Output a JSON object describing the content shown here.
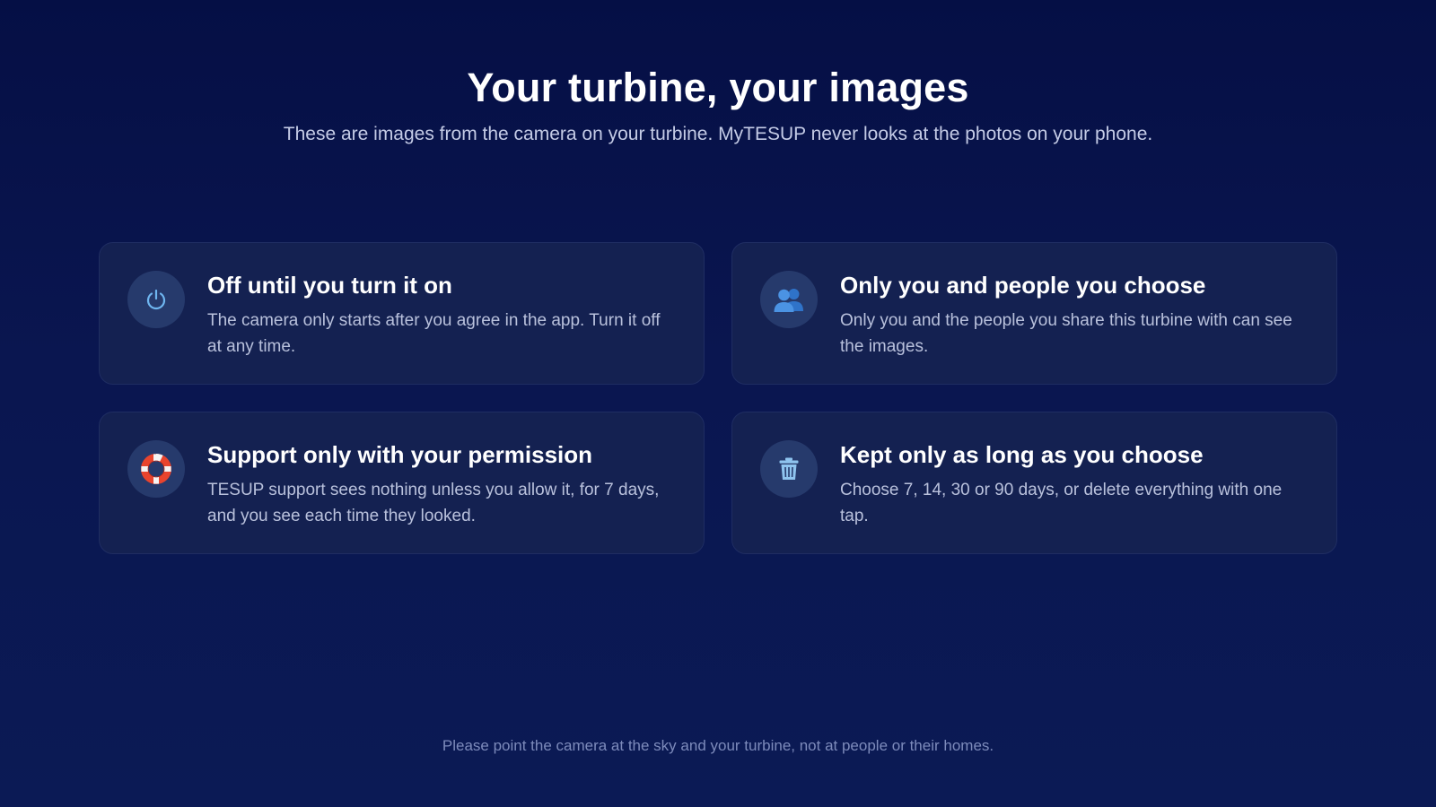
{
  "header": {
    "title": "Your turbine, your images",
    "subtitle": "These are images from the camera on your turbine. MyTESUP never looks at the photos on your phone."
  },
  "cards": [
    {
      "icon": "power-icon",
      "title": "Off until you turn it on",
      "body": "The camera only starts after you agree in the app. Turn it off at any time."
    },
    {
      "icon": "people-icon",
      "title": "Only you and people you choose",
      "body": "Only you and the people you share this turbine with can see the images."
    },
    {
      "icon": "lifebuoy-icon",
      "title": "Support only with your permission",
      "body": "TESUP support sees nothing unless you allow it, for 7 days, and you see each time they looked."
    },
    {
      "icon": "trash-icon",
      "title": "Kept only as long as you choose",
      "body": "Choose 7, 14, 30 or 90 days, or delete everything with one tap."
    }
  ],
  "footer": {
    "note": "Please point the camera at the sky and your turbine, not at people or their homes."
  },
  "colors": {
    "background": "#0a1650",
    "card": "#142151",
    "icon_circle": "#263a6c",
    "accent_blue": "#6fb6f0",
    "lifebuoy_red": "#e8442e"
  }
}
